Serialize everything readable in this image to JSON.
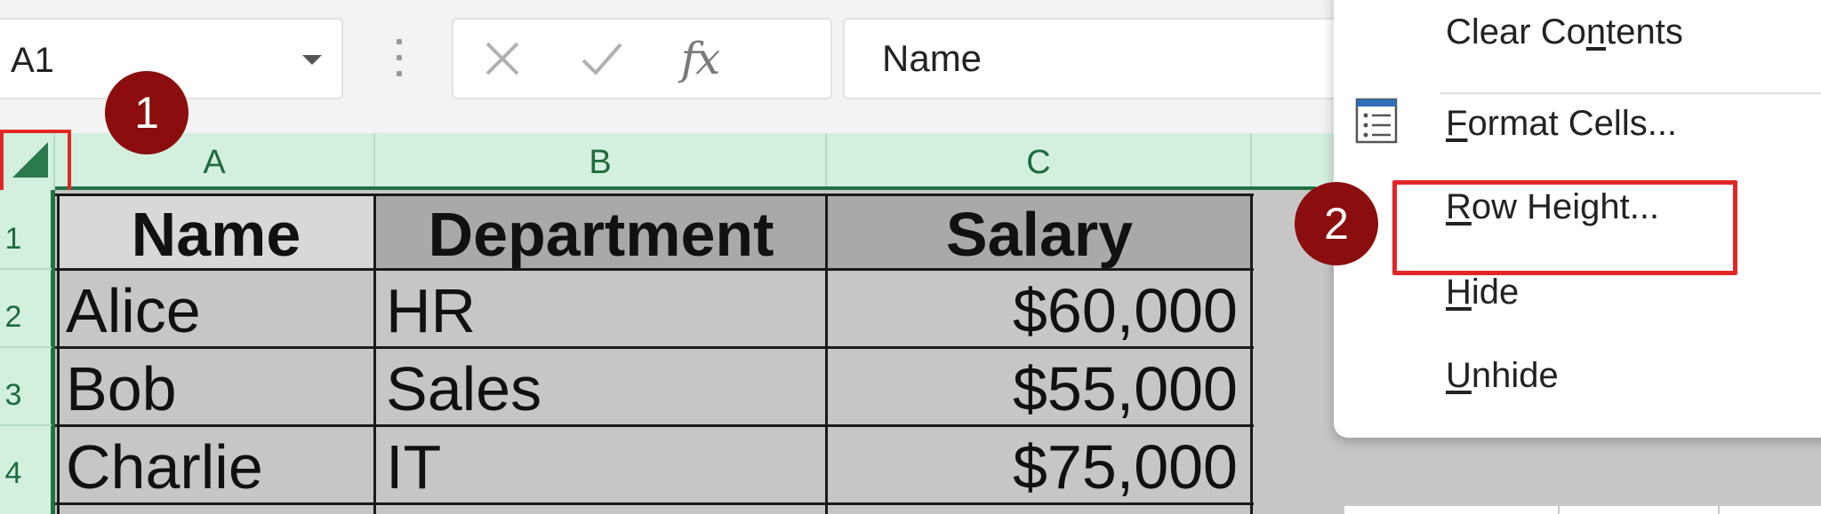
{
  "name_box": {
    "value": "A1"
  },
  "formula_bar": {
    "cancel_icon": "close-icon",
    "enter_icon": "check-icon",
    "fx_label": "fx",
    "value": "Name"
  },
  "columns": [
    "A",
    "B",
    "C"
  ],
  "rows": [
    "1",
    "2",
    "3",
    "4"
  ],
  "table": {
    "headers": [
      "Name",
      "Department",
      "Salary"
    ],
    "data": [
      [
        "Alice",
        "HR",
        "$60,000"
      ],
      [
        "Bob",
        "Sales",
        "$55,000"
      ],
      [
        "Charlie",
        "IT",
        "$75,000"
      ]
    ]
  },
  "context_menu": {
    "items": [
      {
        "pre": "Clear Co",
        "key": "n",
        "post": "tents"
      },
      {
        "pre": "",
        "key": "F",
        "post": "ormat Cells..."
      },
      {
        "pre": "",
        "key": "R",
        "post": "ow Height..."
      },
      {
        "pre": "",
        "key": "H",
        "post": "ide"
      },
      {
        "pre": "",
        "key": "U",
        "post": "nhide"
      }
    ]
  },
  "callouts": [
    "1",
    "2"
  ],
  "colors": {
    "header_green": "#1f7245",
    "header_bg": "#d3f0df",
    "highlight_red": "#e12626",
    "badge_red": "#8b0d0d"
  }
}
